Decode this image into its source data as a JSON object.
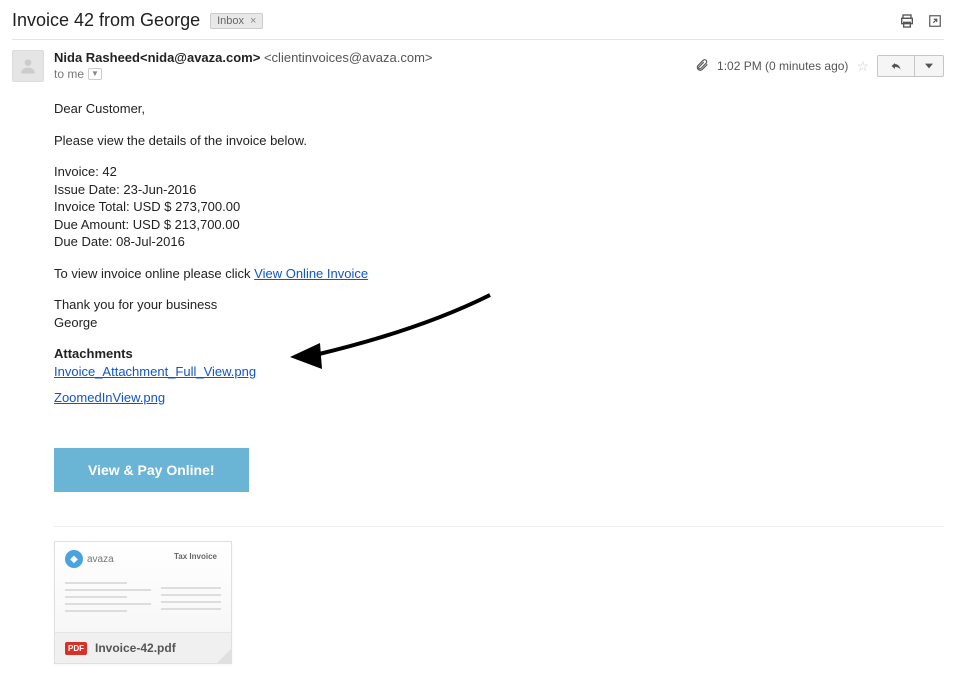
{
  "header": {
    "subject": "Invoice 42 from George",
    "label": "Inbox"
  },
  "message": {
    "from_name": "Nida Rasheed",
    "from_email": "<nida@avaza.com>",
    "reply_to": "<clientinvoices@avaza.com>",
    "to_label": "to me",
    "timestamp": "1:02 PM (0 minutes ago)"
  },
  "body": {
    "greeting": "Dear Customer,",
    "intro": "Please view the details of the invoice below.",
    "invoice_line": "Invoice: 42",
    "issue_line": "Issue Date: 23-Jun-2016",
    "total_line": "Invoice Total: USD $ 273,700.00",
    "due_amount_line": "Due Amount: USD $ 213,700.00",
    "due_date_line": "Due Date: 08-Jul-2016",
    "view_prefix": "To view invoice online please click ",
    "view_link": "View Online Invoice",
    "thanks": "Thank you for your business",
    "sign": "George",
    "attachments_heading": "Attachments",
    "attach_links": [
      "Invoice_Attachment_Full_View.png",
      "ZoomedInView.png"
    ],
    "cta": "View & Pay Online!"
  },
  "attachment_card": {
    "brand": "avaza",
    "doc_title": "Tax Invoice",
    "badge": "PDF",
    "filename": "Invoice-42.pdf"
  }
}
